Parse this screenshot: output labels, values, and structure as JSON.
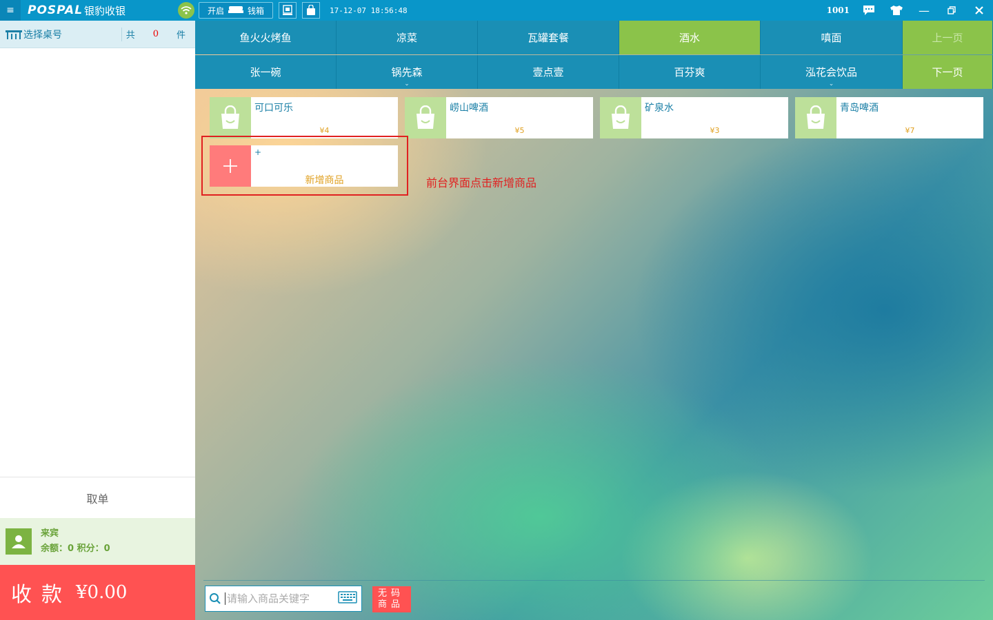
{
  "titlebar": {
    "brand": "POSPAL",
    "brand_cn": "银豹收银",
    "cashbox_label_open": "开启",
    "cashbox_label": "钱箱",
    "datetime": "17-12-07 18:56:48",
    "user_no": "1001"
  },
  "left": {
    "table_select": "选择桌号",
    "total_prefix": "共",
    "total_count": "0",
    "total_unit": "件",
    "fetch_order": "取单",
    "member_name": "来宾",
    "member_balance": "余额：0 积分：0",
    "checkout_label": "收款",
    "checkout_amount": "¥0.00"
  },
  "categories": {
    "row1": [
      "鱼火火烤鱼",
      "凉菜",
      "瓦罐套餐",
      "酒水",
      "嗔面"
    ],
    "row2": [
      "张一碗",
      "锅先森",
      "壹点壹",
      "百芬爽",
      "泓花会饮品"
    ],
    "active": "酒水",
    "prev_page": "上一页",
    "next_page": "下一页"
  },
  "products": [
    {
      "name": "可口可乐",
      "price": "¥4"
    },
    {
      "name": "崂山啤酒",
      "price": "¥5"
    },
    {
      "name": "矿泉水",
      "price": "¥3"
    },
    {
      "name": "青岛啤酒",
      "price": "¥7"
    }
  ],
  "add_product": {
    "plus": "+",
    "label": "新增商品"
  },
  "annotation": "前台界面点击新增商品",
  "search": {
    "placeholder": "请输入商品关键字"
  },
  "noscan_label": "无码商品",
  "colors": {
    "titlebar": "#0996c9",
    "category": "#1a8fb5",
    "active": "#8bc34a",
    "checkout": "#ff5252",
    "annotation": "#e02020"
  }
}
